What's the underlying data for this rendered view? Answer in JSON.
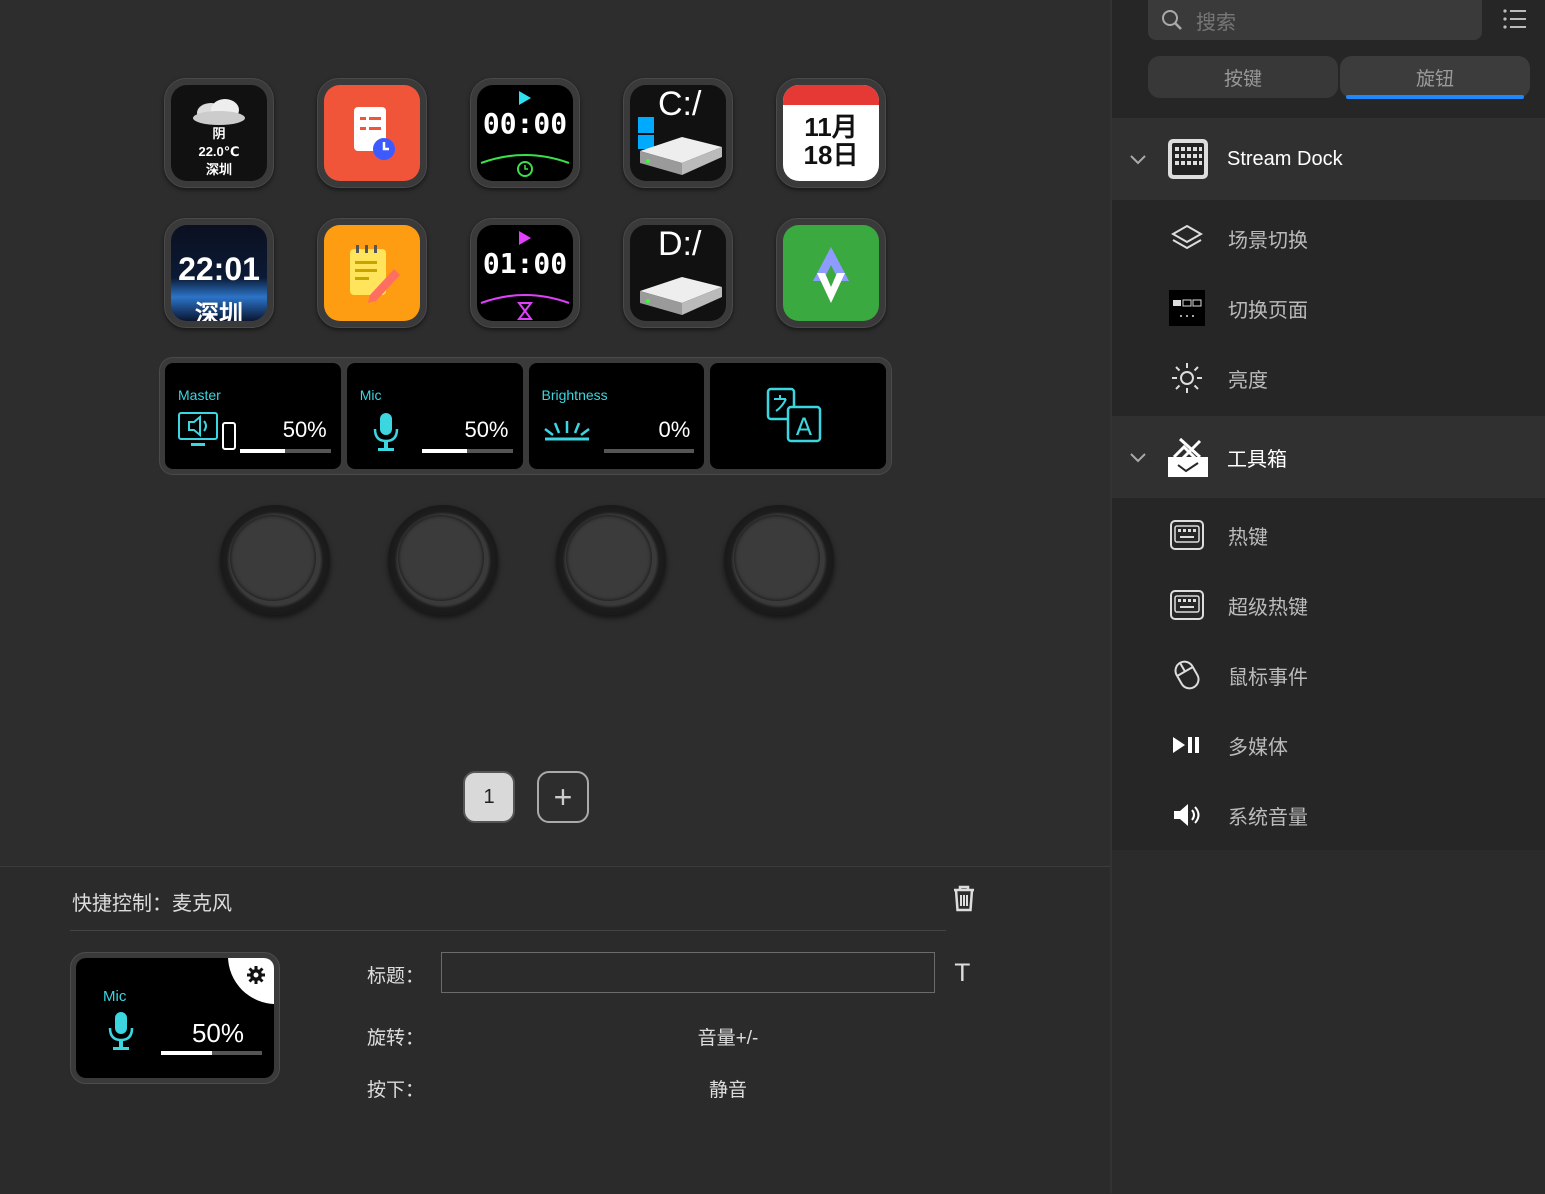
{
  "keys": [
    {
      "id": "weather",
      "condition": "阴",
      "temp": "22.0℃",
      "city": "深圳"
    },
    {
      "id": "task",
      "icon": "checklist-clock-icon"
    },
    {
      "id": "stopwatch",
      "time": "00:00"
    },
    {
      "id": "drive-c",
      "label": "C:/"
    },
    {
      "id": "calendar",
      "month": "11月",
      "day": "18日"
    },
    {
      "id": "clock",
      "time": "22:01",
      "city": "深圳"
    },
    {
      "id": "notes",
      "icon": "notepad-icon"
    },
    {
      "id": "countdown",
      "time": "01:00"
    },
    {
      "id": "drive-d",
      "label": "D:/"
    },
    {
      "id": "app",
      "icon": "green-arrows-icon"
    }
  ],
  "strip": [
    {
      "label": "Master",
      "value": "50%",
      "level": 0.5
    },
    {
      "label": "Mic",
      "value": "50%",
      "level": 0.5
    },
    {
      "label": "Brightness",
      "value": "0%",
      "level": 0.0
    },
    {
      "label": "",
      "icon": "translate-icon"
    }
  ],
  "pages": {
    "current": "1",
    "add": "+"
  },
  "bottom": {
    "title": "快捷控制：麦克风",
    "preview": {
      "label": "Mic",
      "value": "50%",
      "level": 0.5
    },
    "form": {
      "title_label": "标题：",
      "title_value": "",
      "rotate_label": "旋转：",
      "rotate_value": "音量+/-",
      "press_label": "按下：",
      "press_value": "静音"
    }
  },
  "sidebar": {
    "search_placeholder": "搜索",
    "tabs": [
      "按键",
      "旋钮"
    ],
    "active_tab": "旋钮",
    "categories": [
      {
        "name": "Stream Dock",
        "items": [
          "场景切换",
          "切换页面",
          "亮度"
        ]
      },
      {
        "name": "工具箱",
        "items": [
          "热键",
          "超级热键",
          "鼠标事件",
          "多媒体",
          "系统音量"
        ]
      }
    ]
  },
  "colors": {
    "accent": "#1e88ff",
    "cyan": "#3bd6e0"
  }
}
